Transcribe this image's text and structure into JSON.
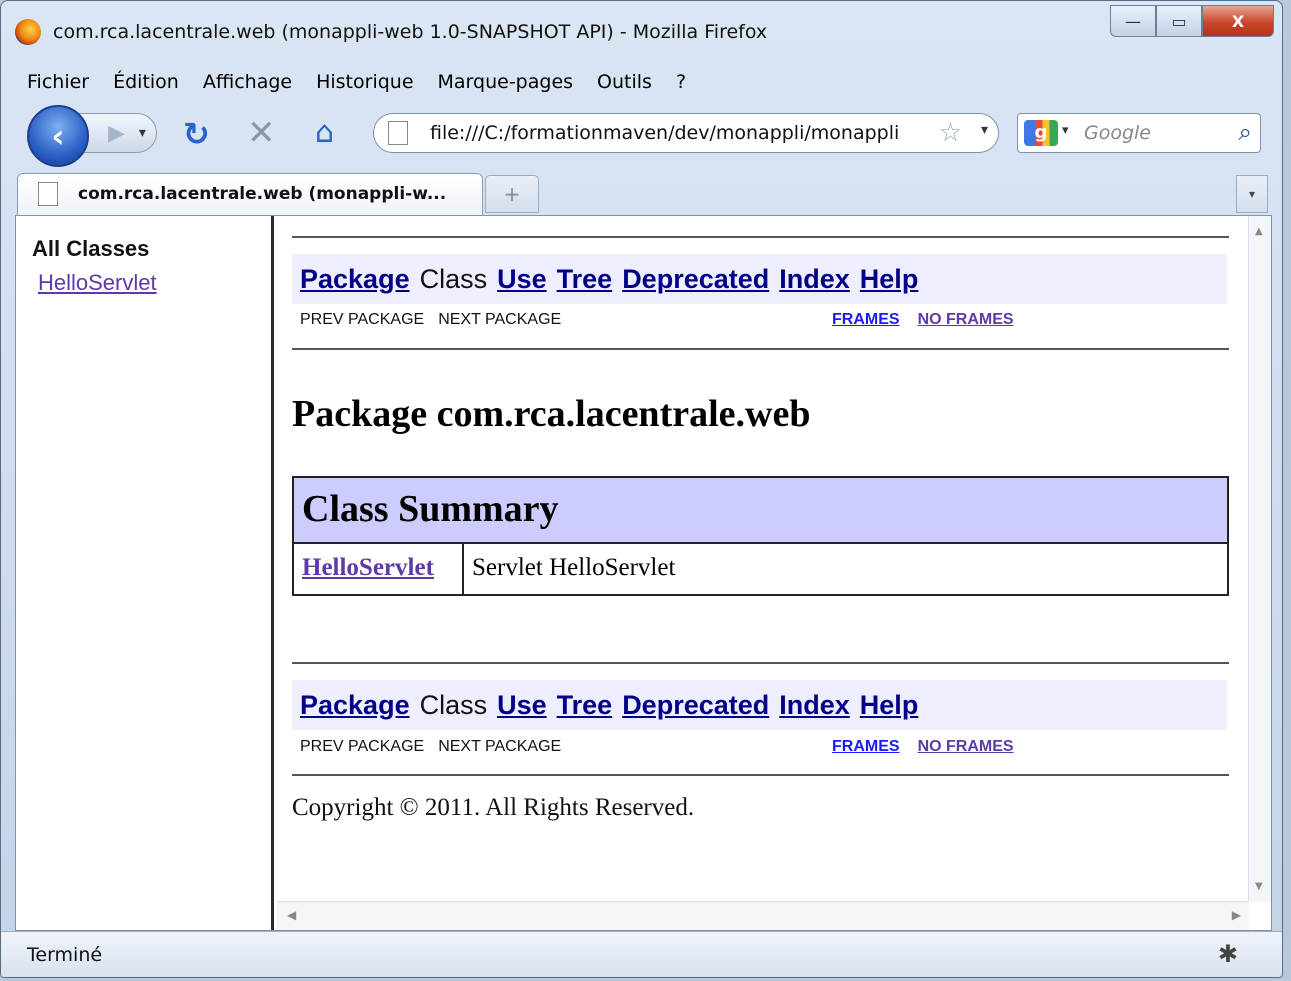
{
  "window": {
    "title": "com.rca.lacentrale.web (monappli-web 1.0-SNAPSHOT API) - Mozilla Firefox",
    "controls": {
      "minimize": "—",
      "maximize": "▭",
      "close": "X"
    }
  },
  "menubar": {
    "items": [
      {
        "label": "Fichier"
      },
      {
        "label": "Édition"
      },
      {
        "label": "Affichage"
      },
      {
        "label": "Historique"
      },
      {
        "label": "Marque-pages"
      },
      {
        "label": "Outils"
      },
      {
        "label": "?"
      }
    ]
  },
  "navbar": {
    "url": "file:///C:/formationmaven/dev/monappli/monappli-web",
    "search_placeholder": "Google"
  },
  "tabs": [
    {
      "label": "com.rca.lacentrale.web (monappli-w..."
    }
  ],
  "left_frame": {
    "heading": "All Classes",
    "classes": [
      "HelloServlet"
    ]
  },
  "doc": {
    "nav": {
      "package": "Package",
      "class": "Class",
      "use": "Use",
      "tree": "Tree",
      "deprecated": "Deprecated",
      "index": "Index",
      "help": "Help",
      "prev_package": "PREV PACKAGE",
      "next_package": "NEXT PACKAGE",
      "frames": "FRAMES",
      "no_frames": "NO FRAMES"
    },
    "package_title": "Package com.rca.lacentrale.web",
    "class_summary": {
      "heading": "Class Summary",
      "rows": [
        {
          "name": "HelloServlet",
          "description": "Servlet HelloServlet"
        }
      ]
    },
    "copyright": "Copyright © 2011. All Rights Reserved."
  },
  "statusbar": {
    "text": "Terminé"
  }
}
